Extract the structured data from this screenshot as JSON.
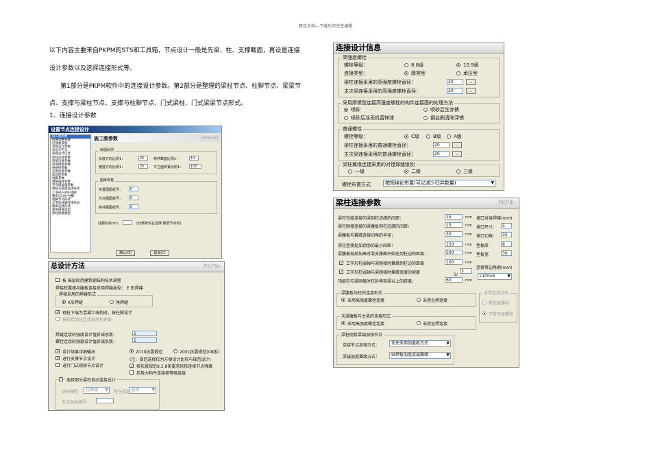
{
  "header": "精品文档---下载后可任意编辑",
  "intro": {
    "p1_line1": "以下内容主要来自PKPM的STS和工具箱，节点设计一般是先梁、柱、支撑截面，再设置连接",
    "p1_line2": "设计参数以及选择连接形式等。",
    "p2_line1": "第1部分是PKPM软件中的连接设计参数。第2部分是整理的梁柱节点、柱脚节点、梁梁节",
    "p2_line2": "点、支撑与梁柱节点、支撑与柱脚节点、门式梁柱、门式梁梁节点形式。",
    "item1": "1、连接设计参数"
  },
  "dlg1": {
    "title": "设置节点连接设计",
    "tree": [
      "施工图参数",
      "抗震调整系数",
      "连接板厚度",
      "连接设计参数",
      "  总设计方法",
      "  连接设计信息",
      "  梁柱连接参数",
      "  梁梁连接参数",
      "  梁梁拼接参数",
      "  柱拼接参数",
      "  支撑连接参数",
      "  加劲肋参数",
      "  柱脚参数",
      "  柱脚锚栓参数",
      "  节点域加强参数",
      "钢柱与底座连接形式",
      "  工字形(H)柱-柱脚",
      "  箱形(口)柱-柱脚",
      "柱脚节点形式",
      "  工字形柱脚连接形式",
      "钢梁连接形式",
      "  梁梁拼接类型",
      "  梁柱刚接类型"
    ],
    "panel_title": "施工图参数",
    "panel_right": "PKPM-STS",
    "g1": "绘图比例",
    "r1a": "长度方向比例1：",
    "v1a": "25",
    "r1b": "构件截面比例1：",
    "v1b": "10",
    "r2a": "宽度方向比例1：",
    "v2a": "25",
    "r2b": "平立面布置比例1：",
    "v2b": "100",
    "g2": "图纸规格",
    "f1": "布置图图纸号：",
    "fv1": "0",
    "f2": "节点图图纸号：",
    "fv2": "0",
    "f3": "构件图图纸号：",
    "fv3": "0",
    "note_l": "柱脚标高(m)：",
    "note_r": "(此参数仅在选择 楼层节点时)",
    "ok": "确认(Q)",
    "cancel": "取消(C)"
  },
  "dlg2": {
    "title": "总设计方法",
    "title_right": "PKPⅢ-",
    "code": "按 高层民用建筑钢结构技术规程",
    "flange_weld": "焊接柱翼缘与腹板连接采用焊缝类型：   E 形焊缝",
    "weld_group": "焊接采用的焊缝形式",
    "weld_a": "K形焊缝",
    "weld_b": "角焊缝",
    "c1": "钢柱下端为混凝土结构时，按柱脚设计",
    "c2": "按铰接梁柱连接采用柱托板",
    "f1": "焊缝连接的强度设计值折减系数：",
    "v1": "1",
    "f2": "螺栓连接的强度设计值折减系数：",
    "v2": "1",
    "c3": "设计结果详细输出",
    "c4": "进行支撑节点设计",
    "c5": "进行门式刚架节点设计",
    "r2010": "2010抗震规范",
    "r2001": "2001抗震规范(08版)",
    "note": "(注：规范选择仅为方便设计比较与规范设计)",
    "c6": "按抗震规范8.2.8条要求校核连接节点强度",
    "c7": "抗剪力构件连接按等强连接",
    "auto": "选择部分梁柱自动连接设计",
    "mtype": "结构模型",
    "mtype_v": "柱翼缘",
    "pos": "所在楼层",
    "pos_v": "选择",
    "node": "节点起始编号："
  },
  "dlg3": {
    "title": "连接设计信息",
    "hs": "高强度螺栓",
    "grade": "螺栓等级：",
    "g88": "8.8级",
    "g109": "10.9级",
    "ctype": "连接类型：",
    "ct1": "摩擦型",
    "ct2": "承压型",
    "d1": "梁柱连接采用的高强度螺栓直径：",
    "d1v": "20",
    "d2": "主次梁连接采用的高强度螺栓直径：",
    "d2v": "20",
    "surf": "采用摩擦型连接高强度螺栓的构件连接面的处理方法",
    "s1": "喷砂",
    "s2": "喷砂后生赤锈",
    "s3": "喷砂后涂无机富锌漆",
    "s4": "钢丝刷清除浮锈",
    "ord": "普通螺栓",
    "og": "螺栓等级：",
    "oc": "C级",
    "ob": "B级",
    "oa": "A级",
    "od1": "梁柱连接采用的普通螺栓直径：",
    "od1v": "20",
    "od2": "主次梁连接采用的普通螺栓直径：",
    "od2v": "20",
    "wg": "梁柱翼缘连接采用的对接焊缝级别",
    "w1": "一级",
    "w2": "二级",
    "w3": "三级",
    "lay": "螺栓布置方式",
    "lay_v": "按规格化布置(可以减少归并数量)"
  },
  "dlg4": {
    "title": "梁柱连接参数",
    "title_right": "PKPⅢ-",
    "rows": [
      {
        "l": "梁柱铰接连接的梁到柱边缘的间距：",
        "v": "15",
        "u": "mm"
      },
      {
        "l": "梁柱刚接连接的梁腹板到柱边缘的间距：",
        "v": "15",
        "u": "mm"
      },
      {
        "l": "梁腹板与翼缘连接切角的半径：",
        "v": "35",
        "u": "mm"
      },
      {
        "l": "梁柱连接处加劲肋的最小间距：",
        "v": "150",
        "u": "mm"
      },
      {
        "l": "梁腹板局部加高时梁支撑面开始处到柱边的距离：",
        "v": "500",
        "u": "mm"
      },
      {
        "l": "工字形柱弱轴与梁刚接时翼缘到柱边的距离",
        "v": "100",
        "u": "mm"
      },
      {
        "l": "工字形柱弱轴与梁刚接时翼缘宽度的坡度",
        "v": "3",
        "u": ""
      },
      {
        "l": "顶层柱与梁刚接时柱延伸到梁以上的距离：",
        "v": "60",
        "u": "mm"
      }
    ],
    "slope_prefix": "1/",
    "rp": [
      {
        "l": "坡口对接焊缝(mm)",
        "v": ""
      },
      {
        "l": "坡口尺寸：",
        "v": "5"
      },
      {
        "l": "坡口切角：",
        "v": "35"
      },
      {
        "l": "垫板厚",
        "v": "8"
      },
      {
        "l": "垫板宽",
        "v": "30"
      }
    ],
    "angle": "连接等边角钢(mm)",
    "angle_v": "L100x6",
    "g1": "梁腹板与柱的连接形式",
    "g1a": "采用高强度螺栓连接",
    "g1b": "采用全焊连接",
    "g2": "全焊连接方式",
    "g2a": "带安装螺栓",
    "g2b": "不带安装螺栓",
    "g3": "次梁腹板与主梁的连接形式",
    "g3a": "采用高强度螺栓连接",
    "g3b": "采用全焊连接",
    "g4": "梁柱刚接梁端加强节点",
    "g4a": "连接节点加强方式：",
    "g4a_v": "优先采用加盖板方式",
    "g4b": "梁端加宽翼缘方式：",
    "g4b_v": "贴焊板加宽梁端翼缘"
  }
}
